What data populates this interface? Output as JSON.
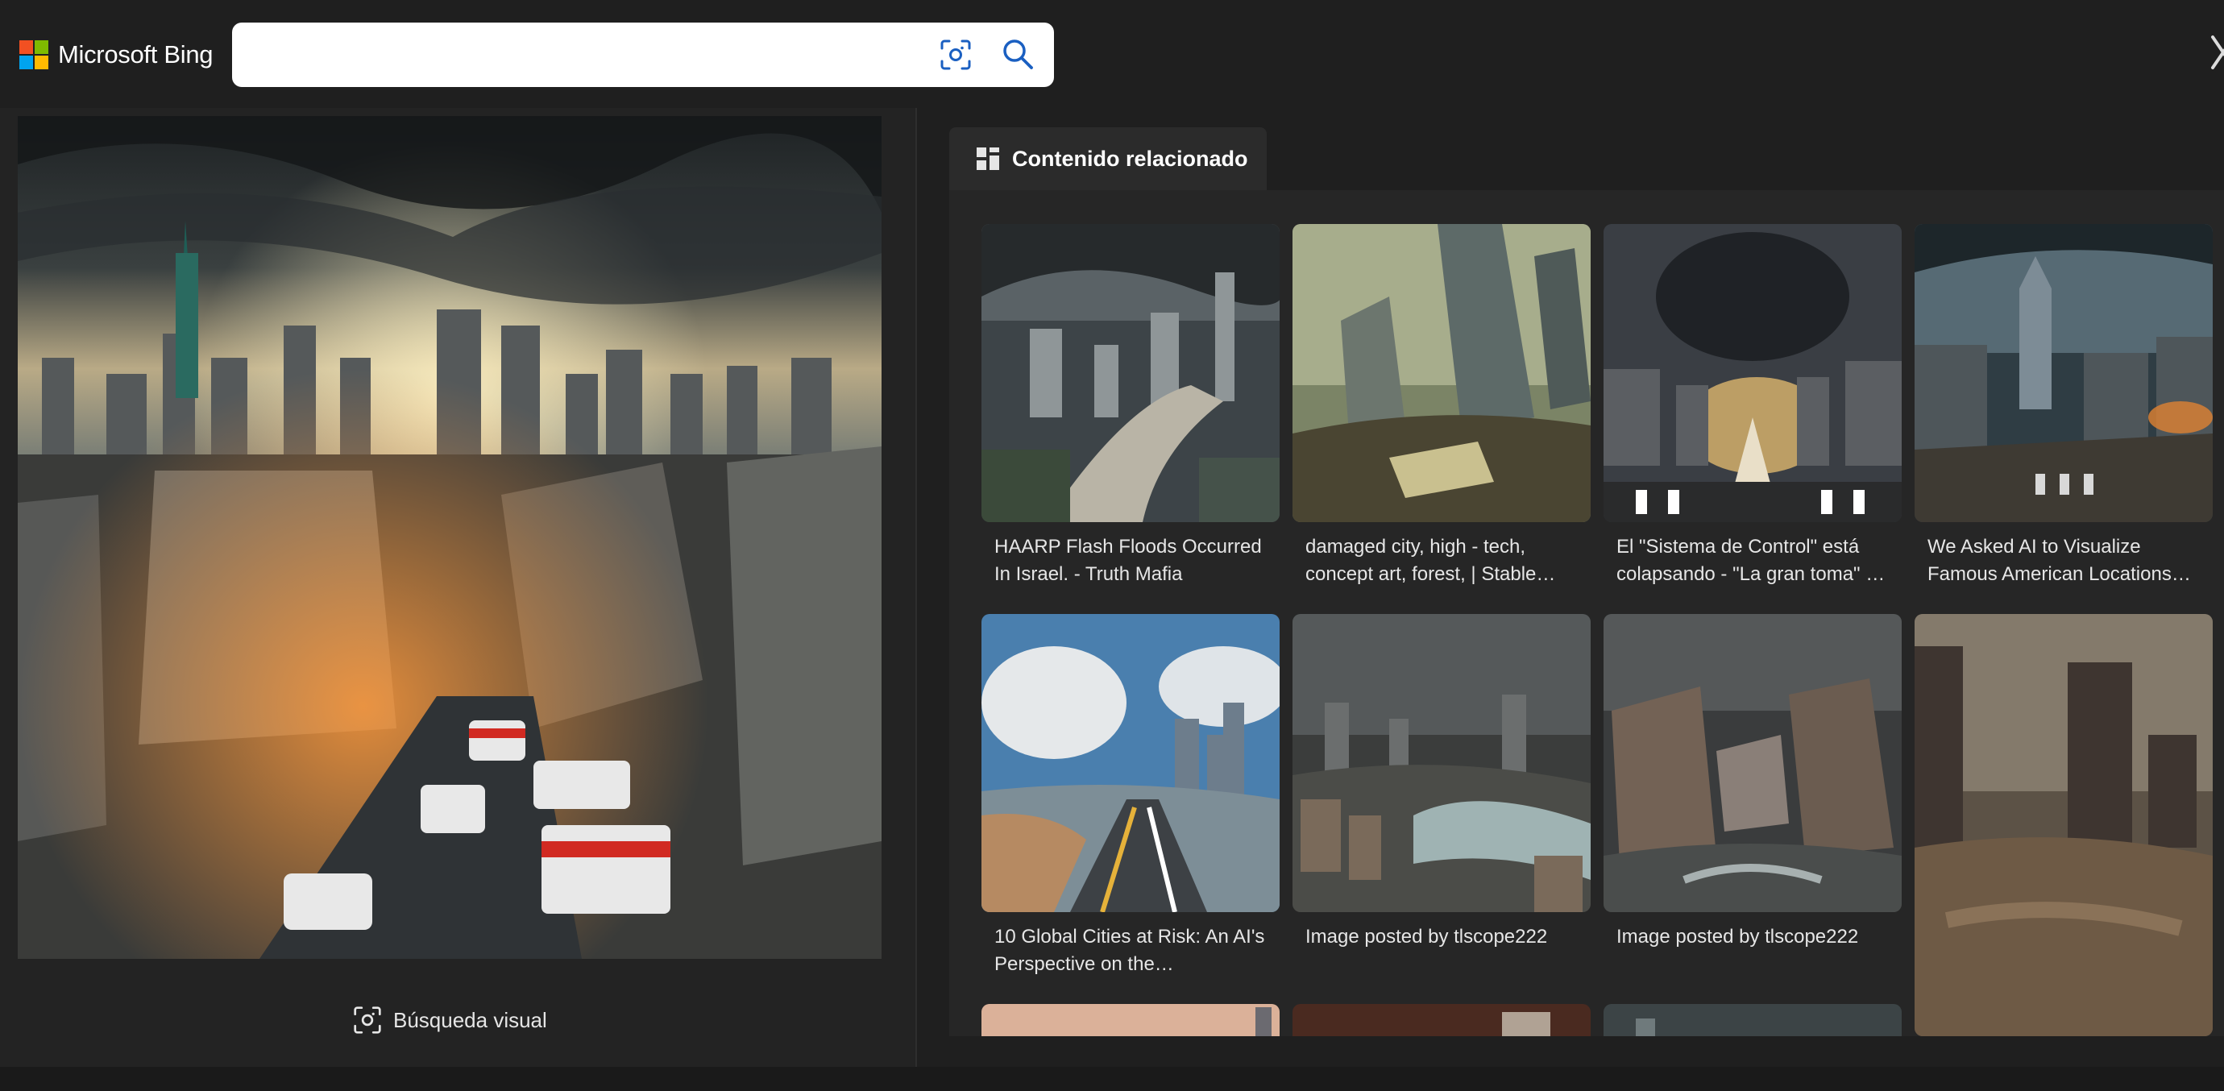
{
  "header": {
    "logo_text": "Microsoft Bing",
    "logo_colors": [
      "#f25022",
      "#7fba00",
      "#00a4ef",
      "#ffb900"
    ],
    "search": {
      "value": "",
      "placeholder": ""
    },
    "icons": {
      "visual_search": "visual-search-icon",
      "search": "search-icon",
      "close": "close-icon"
    },
    "accent": "#1a5fc1"
  },
  "left_pane": {
    "main_image": {
      "description_icon": "image"
    },
    "visual_search_label": "Búsqueda visual"
  },
  "related": {
    "tab_label": "Contenido relacionado",
    "tab_icon": "grid-icon",
    "items": [
      {
        "caption": "HAARP Flash Floods Occurred In Israel. - Truth Mafia"
      },
      {
        "caption": "damaged city, high - tech, concept art, forest, | Stable…"
      },
      {
        "caption": "El \"Sistema de Control\" está colapsando - \"La gran toma\" …"
      },
      {
        "caption": "We Asked AI to Visualize Famous American Locations…"
      },
      {
        "caption": "10 Global Cities at Risk: An AI's Perspective on the…"
      },
      {
        "caption": "Image posted by tlscope222"
      },
      {
        "caption": "Image posted by tlscope222"
      },
      {
        "caption": ""
      }
    ]
  }
}
